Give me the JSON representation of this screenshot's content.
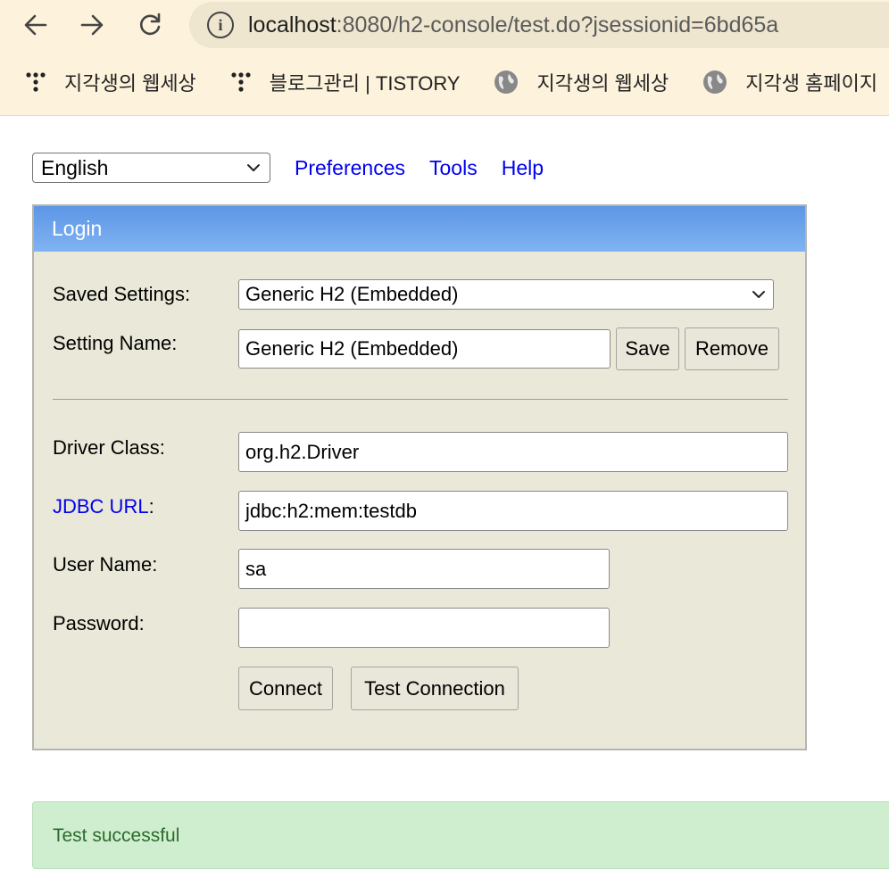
{
  "browser": {
    "url_host": "localhost",
    "url_rest": ":8080/h2-console/test.do?jsessionid=6bd65a",
    "bookmarks": [
      {
        "label": "지각생의 웹세상",
        "icon": "tistory-dots-icon"
      },
      {
        "label": "블로그관리 | TISTORY",
        "icon": "tistory-dots-icon"
      },
      {
        "label": "지각생의 웹세상",
        "icon": "globe-icon"
      },
      {
        "label": "지각생 홈페이지",
        "icon": "globe-icon"
      }
    ]
  },
  "toolbar": {
    "language": "English",
    "links": [
      "Preferences",
      "Tools",
      "Help"
    ]
  },
  "login": {
    "title": "Login",
    "saved_settings_label": "Saved Settings:",
    "saved_settings_value": "Generic H2 (Embedded)",
    "setting_name_label": "Setting Name:",
    "setting_name_value": "Generic H2 (Embedded)",
    "save_label": "Save",
    "remove_label": "Remove",
    "driver_class_label": "Driver Class:",
    "driver_class_value": "org.h2.Driver",
    "jdbc_url_link": "JDBC URL",
    "jdbc_url_colon": ":",
    "jdbc_url_value": "jdbc:h2:mem:testdb",
    "user_name_label": "User Name:",
    "user_name_value": "sa",
    "password_label": "Password:",
    "password_value": "",
    "connect_label": "Connect",
    "test_connection_label": "Test Connection"
  },
  "status": {
    "message": "Test successful"
  },
  "colors": {
    "header_gradient_top": "#5d96e6",
    "panel_bg": "#eae8d8",
    "success_bg": "#cfeecf",
    "success_text": "#2c6b2c",
    "link": "#0000ee"
  }
}
